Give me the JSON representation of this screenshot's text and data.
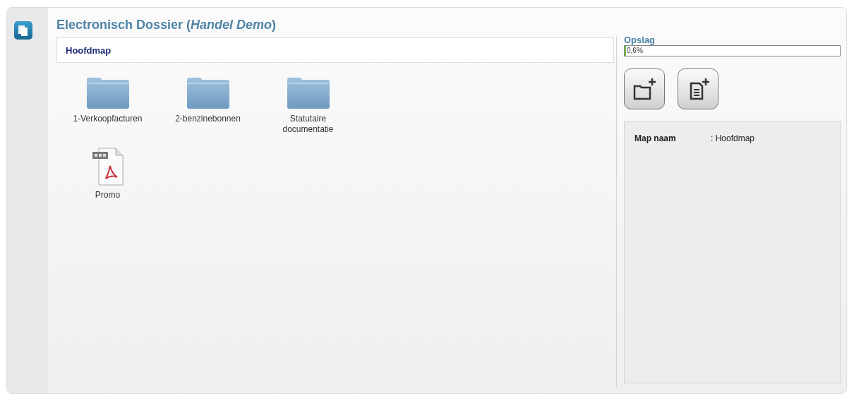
{
  "title": "Electronisch Dossier (*Handel Demo*)",
  "breadcrumb": "Hoofdmap",
  "items": [
    {
      "kind": "folder",
      "label": "1-Verkoopfacturen"
    },
    {
      "kind": "folder",
      "label": "2-benzinebonnen"
    },
    {
      "kind": "folder",
      "label": "Statutaire documentatie"
    },
    {
      "kind": "pdf",
      "label": "Promo"
    }
  ],
  "storage": {
    "label": "Opslag",
    "level": 0.006,
    "reading": "0,6%"
  },
  "details": [
    {
      "label": "Map naam",
      "value": ": Hoofdmap"
    }
  ]
}
